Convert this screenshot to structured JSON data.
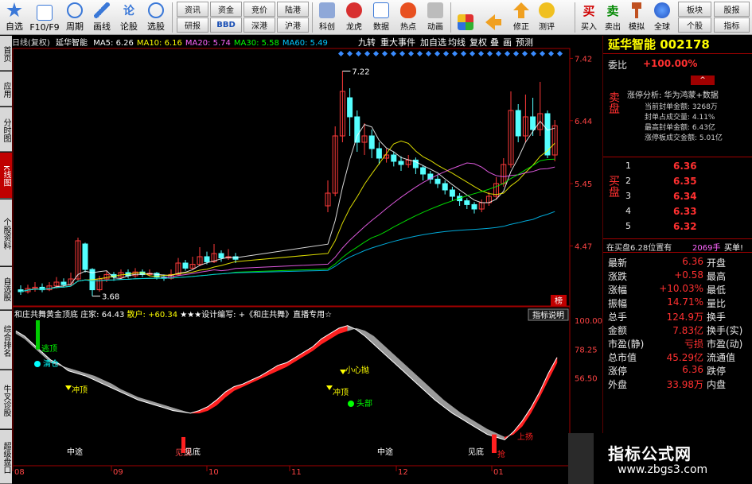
{
  "toolbar": {
    "buttons": [
      {
        "label": "自选",
        "icon": "star-icon"
      },
      {
        "label": "F10/F9",
        "icon": "document-icon"
      },
      {
        "label": "周期",
        "icon": "clock-icon"
      },
      {
        "label": "画线",
        "icon": "pen-icon"
      },
      {
        "label": "论股",
        "icon": "chat-icon"
      },
      {
        "label": "选股",
        "icon": "chart-search-icon"
      }
    ],
    "small_row1": [
      "资讯",
      "资金",
      "竞价",
      "陆港"
    ],
    "small_row2": [
      "研报",
      "BBD",
      "深港",
      "沪港"
    ],
    "right_buttons": [
      "科创",
      "龙虎",
      "数据",
      "热点",
      "动画",
      "修正",
      "测评",
      "买入",
      "卖出",
      "模拟",
      "全球",
      "板块",
      "股报",
      "个股",
      "指标"
    ]
  },
  "left_tabs": [
    "首页",
    "应用",
    "分时图",
    "K线图",
    "个股资料",
    "自选股",
    "综合排名",
    "牛叉诊股",
    "超级盘口"
  ],
  "main_chart": {
    "title_prefix": "日线(复权)",
    "stock_name": "延华智能",
    "ma": [
      {
        "label": "MA5: 6.26",
        "color": "#ffffff"
      },
      {
        "label": "MA10: 6.16",
        "color": "#ffff00"
      },
      {
        "label": "MA20: 5.74",
        "color": "#ff66ff"
      },
      {
        "label": "MA30: 5.58",
        "color": "#00ff00"
      },
      {
        "label": "MA60: 5.49",
        "color": "#00c8ff"
      }
    ],
    "header_buttons": [
      "九转",
      "重大事件",
      "加自选",
      "均线",
      "复权",
      "叠",
      "画",
      "预测"
    ],
    "right_axis": [
      "7.42",
      "6.44",
      "5.45",
      "4.47"
    ],
    "annotations": {
      "high": "7.22",
      "low": "3.68"
    },
    "badge": "榜"
  },
  "chart_data": {
    "type": "candlestick",
    "title": "延华智能",
    "y_axis": {
      "ticks": [
        7.42,
        6.44,
        5.45,
        4.47
      ]
    },
    "candles": [
      {
        "o": 3.78,
        "c": 3.75,
        "h": 3.85,
        "l": 3.7
      },
      {
        "o": 3.75,
        "c": 3.8,
        "h": 3.86,
        "l": 3.72
      },
      {
        "o": 3.8,
        "c": 3.82,
        "h": 3.9,
        "l": 3.75
      },
      {
        "o": 3.82,
        "c": 3.78,
        "h": 3.88,
        "l": 3.74
      },
      {
        "o": 3.78,
        "c": 3.84,
        "h": 3.9,
        "l": 3.76
      },
      {
        "o": 3.84,
        "c": 3.9,
        "h": 3.98,
        "l": 3.8
      },
      {
        "o": 3.9,
        "c": 3.86,
        "h": 3.96,
        "l": 3.82
      },
      {
        "o": 3.86,
        "c": 3.95,
        "h": 4.05,
        "l": 3.84
      },
      {
        "o": 3.95,
        "c": 4.55,
        "h": 4.6,
        "l": 3.92
      },
      {
        "o": 4.5,
        "c": 4.1,
        "h": 4.52,
        "l": 4.05
      },
      {
        "o": 4.1,
        "c": 3.78,
        "h": 4.12,
        "l": 3.68
      },
      {
        "o": 3.78,
        "c": 3.95,
        "h": 4.0,
        "l": 3.75
      },
      {
        "o": 3.95,
        "c": 4.02,
        "h": 4.08,
        "l": 3.9
      },
      {
        "o": 4.02,
        "c": 3.98,
        "h": 4.06,
        "l": 3.92
      },
      {
        "o": 3.98,
        "c": 4.05,
        "h": 4.1,
        "l": 3.95
      },
      {
        "o": 4.05,
        "c": 4.0,
        "h": 4.1,
        "l": 3.96
      },
      {
        "o": 4.0,
        "c": 4.06,
        "h": 4.12,
        "l": 3.97
      },
      {
        "o": 4.06,
        "c": 4.02,
        "h": 4.1,
        "l": 3.98
      },
      {
        "o": 4.02,
        "c": 4.04,
        "h": 4.1,
        "l": 3.99
      },
      {
        "o": 4.04,
        "c": 3.98,
        "h": 4.06,
        "l": 3.94
      },
      {
        "o": 3.98,
        "c": 3.96,
        "h": 4.02,
        "l": 3.92
      },
      {
        "o": 3.96,
        "c": 4.02,
        "h": 4.1,
        "l": 3.94
      },
      {
        "o": 4.02,
        "c": 4.2,
        "h": 4.28,
        "l": 4.0
      },
      {
        "o": 4.2,
        "c": 4.12,
        "h": 4.25,
        "l": 4.08
      },
      {
        "o": 4.12,
        "c": 4.18,
        "h": 4.3,
        "l": 4.1
      },
      {
        "o": 4.18,
        "c": 4.3,
        "h": 4.45,
        "l": 4.15
      },
      {
        "o": 4.3,
        "c": 4.22,
        "h": 4.38,
        "l": 4.18
      },
      {
        "o": 4.22,
        "c": 4.35,
        "h": 4.5,
        "l": 4.2
      },
      {
        "o": 4.35,
        "c": 4.28,
        "h": 4.4,
        "l": 4.22
      },
      {
        "o": 4.28,
        "c": 4.3,
        "h": 4.42,
        "l": 4.25
      },
      {
        "o": 4.3,
        "c": 4.26,
        "h": 4.36,
        "l": 4.2
      },
      {
        "o": 5.1,
        "c": 5.3,
        "h": 5.5,
        "l": 5.0
      },
      {
        "o": 5.3,
        "c": 6.2,
        "h": 6.35,
        "l": 5.25
      },
      {
        "o": 6.2,
        "c": 6.9,
        "h": 7.22,
        "l": 6.1
      },
      {
        "o": 6.8,
        "c": 6.5,
        "h": 6.95,
        "l": 6.2
      },
      {
        "o": 6.5,
        "c": 6.1,
        "h": 6.6,
        "l": 5.95
      },
      {
        "o": 6.1,
        "c": 6.2,
        "h": 6.4,
        "l": 5.9
      },
      {
        "o": 6.2,
        "c": 6.0,
        "h": 6.3,
        "l": 5.85
      },
      {
        "o": 6.0,
        "c": 5.85,
        "h": 6.1,
        "l": 5.75
      },
      {
        "o": 5.85,
        "c": 5.9,
        "h": 6.0,
        "l": 5.78
      },
      {
        "o": 5.9,
        "c": 5.8,
        "h": 5.95,
        "l": 5.72
      },
      {
        "o": 5.8,
        "c": 5.75,
        "h": 5.88,
        "l": 5.65
      },
      {
        "o": 5.75,
        "c": 5.82,
        "h": 5.9,
        "l": 5.7
      },
      {
        "o": 5.82,
        "c": 5.7,
        "h": 5.86,
        "l": 5.6
      },
      {
        "o": 5.7,
        "c": 5.6,
        "h": 5.74,
        "l": 5.5
      },
      {
        "o": 5.6,
        "c": 5.52,
        "h": 5.65,
        "l": 5.45
      },
      {
        "o": 5.52,
        "c": 5.45,
        "h": 5.58,
        "l": 5.38
      },
      {
        "o": 5.45,
        "c": 5.35,
        "h": 5.5,
        "l": 5.28
      },
      {
        "o": 5.35,
        "c": 5.25,
        "h": 5.4,
        "l": 5.18
      },
      {
        "o": 5.25,
        "c": 5.18,
        "h": 5.3,
        "l": 5.1
      },
      {
        "o": 5.18,
        "c": 5.12,
        "h": 5.22,
        "l": 5.05
      },
      {
        "o": 5.12,
        "c": 5.05,
        "h": 5.16,
        "l": 4.98
      },
      {
        "o": 5.05,
        "c": 5.15,
        "h": 5.2,
        "l": 5.0
      },
      {
        "o": 5.15,
        "c": 5.25,
        "h": 5.32,
        "l": 5.1
      },
      {
        "o": 5.25,
        "c": 5.45,
        "h": 5.55,
        "l": 5.2
      },
      {
        "o": 5.45,
        "c": 5.75,
        "h": 5.85,
        "l": 5.4
      },
      {
        "o": 5.75,
        "c": 6.6,
        "h": 6.9,
        "l": 5.7
      },
      {
        "o": 6.6,
        "c": 6.2,
        "h": 6.7,
        "l": 6.1
      },
      {
        "o": 6.2,
        "c": 6.5,
        "h": 6.85,
        "l": 6.1
      },
      {
        "o": 6.5,
        "c": 6.3,
        "h": 6.8,
        "l": 6.2
      },
      {
        "o": 6.3,
        "c": 6.55,
        "h": 7.05,
        "l": 6.2
      },
      {
        "o": 6.55,
        "c": 5.9,
        "h": 6.6,
        "l": 5.85
      },
      {
        "o": 5.9,
        "c": 6.36,
        "h": 6.45,
        "l": 5.8
      }
    ],
    "indicator": {
      "name": "和庄共舞黄金顶底",
      "zhuangjia": "64.43",
      "sanhu": "+60.34",
      "y_ticks": [
        100.0,
        78.25,
        56.5
      ],
      "zhuang_values": [
        92,
        88,
        82,
        76,
        70,
        67,
        62,
        60,
        58,
        55,
        52,
        49,
        46,
        43,
        40,
        38,
        36,
        34,
        32,
        31,
        30,
        32,
        35,
        40,
        46,
        50,
        52,
        55,
        58,
        62,
        66,
        68,
        72,
        76,
        80,
        86,
        90,
        94,
        96,
        93,
        88,
        82,
        76,
        70,
        64,
        58,
        52,
        46,
        40,
        35,
        30,
        26,
        22,
        18,
        14,
        12,
        10,
        16,
        24,
        34,
        46,
        60,
        72
      ],
      "sanhu_values": [
        90,
        86,
        80,
        74,
        68,
        66,
        64,
        62,
        60,
        58,
        55,
        52,
        48,
        45,
        42,
        40,
        38,
        36,
        34,
        32,
        30,
        30,
        32,
        36,
        42,
        47,
        50,
        53,
        56,
        59,
        62,
        65,
        69,
        73,
        77,
        82,
        86,
        90,
        92,
        94,
        92,
        88,
        82,
        76,
        70,
        64,
        58,
        52,
        46,
        40,
        35,
        30,
        26,
        22,
        18,
        15,
        12,
        14,
        20,
        30,
        42,
        55,
        68
      ]
    }
  },
  "indicator_panel": {
    "title": "和庄共舞黄金顶底",
    "zhuang_label": "庄家: 64.43",
    "sanhu_label": "散户: +60.34",
    "design_label": "★★★设计编写: +《和庄共舞》直播专用☆",
    "button": "指标说明",
    "right_axis": [
      "100.00",
      "78.25",
      "56.50"
    ],
    "signals": [
      "逃顶",
      "清仓",
      "冲顶",
      "见顶",
      "小心抛",
      "冲顶",
      "头部",
      "见底",
      "中途",
      "见底",
      "中途",
      "上扬",
      "抢"
    ],
    "time_labels": [
      "08",
      "09",
      "10",
      "11",
      "12",
      "01"
    ]
  },
  "quote_panel": {
    "title": "延华智能 002178",
    "weibi_label": "委比",
    "weibi_value": "+100.00%",
    "zhangting_title": "涨停分析: 华为鸿蒙+数据",
    "zt_lines": [
      "当前封单金额: 3268万",
      "封单占成交量: 4.11%",
      "最高封单金额: 6.43亿",
      "涨停板成交金额: 5.01亿"
    ],
    "sell_label": "卖盘",
    "buy_label": "买盘",
    "buy_levels": [
      {
        "no": "1",
        "price": "6.36"
      },
      {
        "no": "2",
        "price": "6.35"
      },
      {
        "no": "3",
        "price": "6.34"
      },
      {
        "no": "4",
        "price": "6.33"
      },
      {
        "no": "5",
        "price": "6.32"
      }
    ],
    "buy_note": "在买盘6.28位置有",
    "buy_note_vol": "2069手",
    "buy_note_tag": "买单!",
    "stats": [
      {
        "l": "最新",
        "v": "6.36",
        "r": "开盘"
      },
      {
        "l": "涨跌",
        "v": "+0.58",
        "r": "最高"
      },
      {
        "l": "涨幅",
        "v": "+10.03%",
        "r": "最低"
      },
      {
        "l": "振幅",
        "v": "14.71%",
        "r": "量比"
      },
      {
        "l": "总手",
        "v": "124.9万",
        "r": "换手"
      },
      {
        "l": "金额",
        "v": "7.83亿",
        "r": "换手(实)"
      },
      {
        "l": "市盈(静)",
        "v": "亏损",
        "r": "市盈(动)"
      },
      {
        "l": "总市值",
        "v": "45.29亿",
        "r": "流通值"
      },
      {
        "l": "涨停",
        "v": "6.36",
        "r": "跌停"
      },
      {
        "l": "外盘",
        "v": "33.98万",
        "r": "内盘"
      }
    ]
  },
  "watermark": {
    "title": "指标公式网",
    "url": "www.zbgs3.com"
  },
  "colors": {
    "up": "#ff3a3a",
    "down": "#55ffff",
    "background": "#000000",
    "axis": "#a00000"
  }
}
